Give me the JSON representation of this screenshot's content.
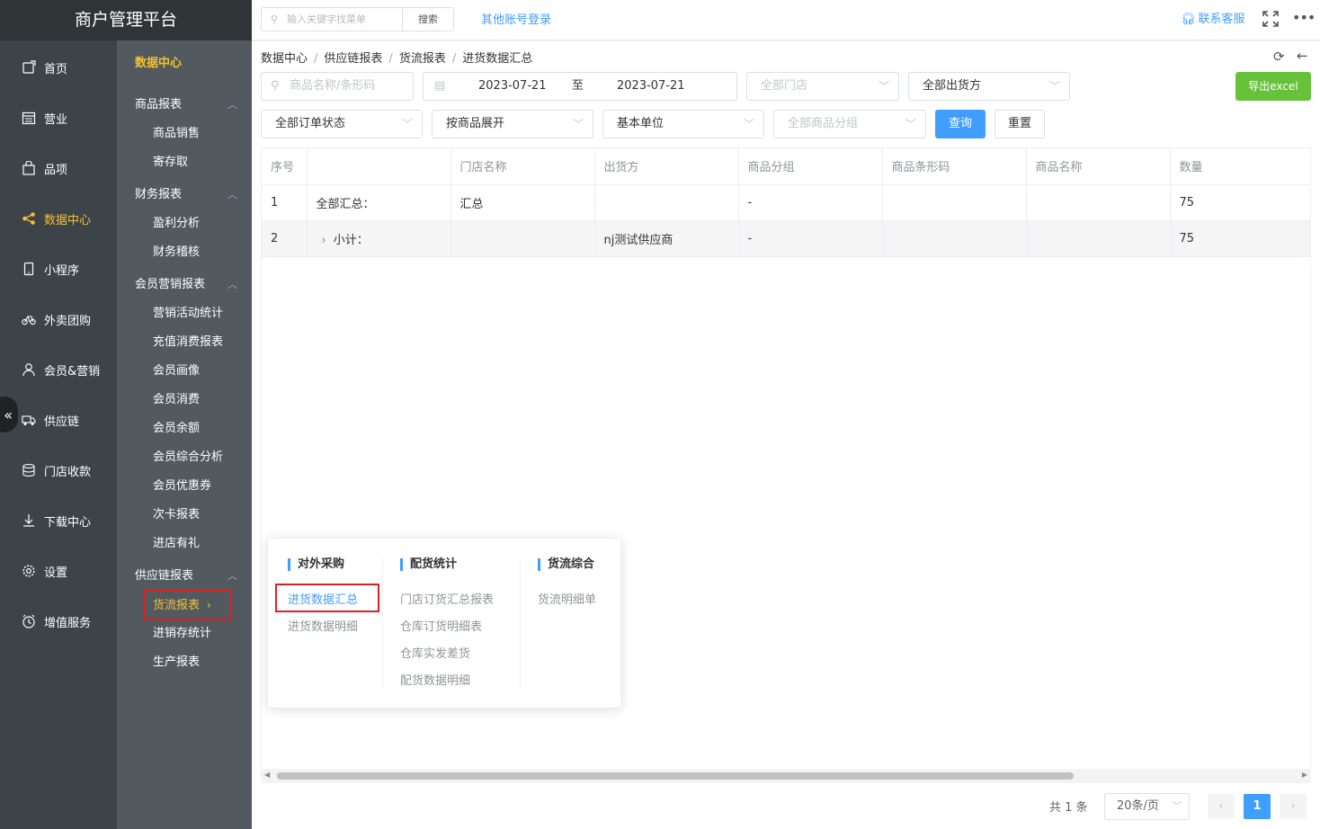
{
  "app": {
    "title": "商户管理平台"
  },
  "nav": {
    "items": [
      {
        "label": "首页",
        "icon": "home-icon"
      },
      {
        "label": "营业",
        "icon": "calendar-icon"
      },
      {
        "label": "品项",
        "icon": "bag-icon"
      },
      {
        "label": "数据中心",
        "icon": "share-icon",
        "active": true
      },
      {
        "label": "小程序",
        "icon": "phone-icon"
      },
      {
        "label": "外卖团购",
        "icon": "bike-icon"
      },
      {
        "label": "会员&营销",
        "icon": "user-icon"
      },
      {
        "label": "供应链",
        "icon": "truck-icon"
      },
      {
        "label": "门店收款",
        "icon": "database-icon"
      },
      {
        "label": "下载中心",
        "icon": "download-icon"
      },
      {
        "label": "设置",
        "icon": "gear-icon"
      },
      {
        "label": "增值服务",
        "icon": "clock-icon"
      }
    ]
  },
  "subnav": {
    "title": "数据中心",
    "groups": [
      {
        "label": "商品报表",
        "items": [
          "商品销售",
          "寄存取"
        ]
      },
      {
        "label": "财务报表",
        "items": [
          "盈利分析",
          "财务稽核"
        ]
      },
      {
        "label": "会员营销报表",
        "items": [
          "营销活动统计",
          "充值消费报表",
          "会员画像",
          "会员消费",
          "会员余额",
          "会员综合分析",
          "会员优惠券",
          "次卡报表",
          "进店有礼"
        ]
      },
      {
        "label": "供应链报表",
        "items": [
          "货流报表",
          "进销存统计",
          "生产报表"
        ]
      }
    ]
  },
  "topbar": {
    "search_placeholder": "输入关键字找菜单",
    "search_button": "搜索",
    "other_login": "其他账号登录",
    "service": "联系客服"
  },
  "breadcrumb": [
    "数据中心",
    "供应链报表",
    "货流报表",
    "进货数据汇总"
  ],
  "filters": {
    "product_placeholder": "商品名称/条形码",
    "date_start": "2023-07-21",
    "date_to": "至",
    "date_end": "2023-07-21",
    "store": "全部门店",
    "shipper": "全部出货方",
    "order_status": "全部订单状态",
    "expand": "按商品展开",
    "unit": "基本单位",
    "group": "全部商品分组",
    "query_button": "查询",
    "reset_button": "重置",
    "export_button": "导出excel"
  },
  "table": {
    "columns": [
      "序号",
      "",
      "门店名称",
      "出货方",
      "商品分组",
      "商品条形码",
      "商品名称",
      "数量"
    ],
    "rows": [
      [
        "1",
        "全部汇总：",
        "汇总",
        "",
        "-",
        "",
        "",
        "75"
      ],
      [
        "2",
        "小计：",
        "",
        "nj测试供应商",
        "-",
        "",
        "",
        "75"
      ]
    ]
  },
  "pager": {
    "total": "共 1 条",
    "page_size": "20条/页",
    "current": "1"
  },
  "popup": {
    "cols": [
      {
        "title": "对外采购",
        "items": [
          "进货数据汇总",
          "进货数据明细"
        ]
      },
      {
        "title": "配货统计",
        "items": [
          "门店订货汇总报表",
          "仓库订货明细表",
          "仓库实发差货",
          "配货数据明细"
        ]
      },
      {
        "title": "货流综合",
        "items": [
          "货流明细单"
        ]
      }
    ]
  },
  "colors": {
    "accent": "#409eff",
    "active_nav": "#f5c033",
    "export": "#67c23a",
    "highlight_box": "#e02020"
  }
}
